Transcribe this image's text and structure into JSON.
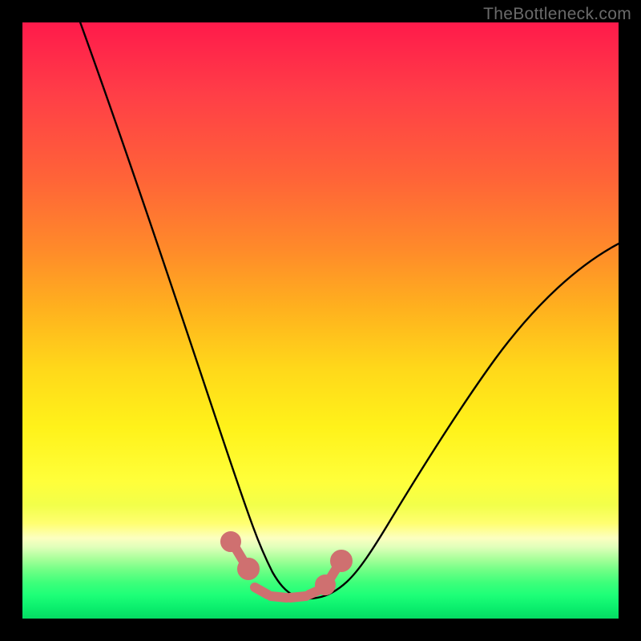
{
  "watermark": "TheBottleneck.com",
  "colors": {
    "frame_background": "#000000",
    "curve_stroke": "#000000",
    "marker_fill": "#cf7070",
    "gradient_top": "#ff1a4b",
    "gradient_mid": "#fff21a",
    "gradient_bottom": "#05db63"
  },
  "chart_data": {
    "type": "line",
    "title": "",
    "xlabel": "",
    "ylabel": "",
    "xlim": [
      0,
      100
    ],
    "ylim": [
      0,
      100
    ],
    "x": [
      0,
      5,
      10,
      15,
      20,
      25,
      30,
      32,
      34,
      36,
      38,
      40,
      42,
      44,
      46,
      48,
      50,
      55,
      60,
      65,
      70,
      75,
      80,
      85,
      90,
      95,
      100
    ],
    "values": [
      100,
      86,
      72,
      58,
      45,
      32,
      20,
      15,
      10,
      6,
      3,
      1,
      0,
      0,
      0,
      1,
      3,
      9,
      17,
      25,
      32,
      39,
      45,
      50,
      55,
      59,
      63
    ],
    "series": [
      {
        "name": "bottleneck-curve",
        "x": [
          0,
          5,
          10,
          15,
          20,
          25,
          30,
          32,
          34,
          36,
          38,
          40,
          42,
          44,
          46,
          48,
          50,
          55,
          60,
          65,
          70,
          75,
          80,
          85,
          90,
          95,
          100
        ],
        "values": [
          100,
          86,
          72,
          58,
          45,
          32,
          20,
          15,
          10,
          6,
          3,
          1,
          0,
          0,
          0,
          1,
          3,
          9,
          17,
          25,
          32,
          39,
          45,
          50,
          55,
          59,
          63
        ]
      }
    ],
    "markers": {
      "style": "dots-and-links",
      "points": [
        {
          "x": 34.0,
          "y": 10.5
        },
        {
          "x": 35.5,
          "y": 7.0
        },
        {
          "x": 37.0,
          "y": 4.5
        },
        {
          "x": 39.0,
          "y": 3.2
        },
        {
          "x": 41.0,
          "y": 2.6
        },
        {
          "x": 43.0,
          "y": 2.6
        },
        {
          "x": 45.0,
          "y": 3.0
        },
        {
          "x": 47.0,
          "y": 4.2
        },
        {
          "x": 48.2,
          "y": 6.0
        },
        {
          "x": 50.0,
          "y": 8.0
        }
      ]
    }
  }
}
